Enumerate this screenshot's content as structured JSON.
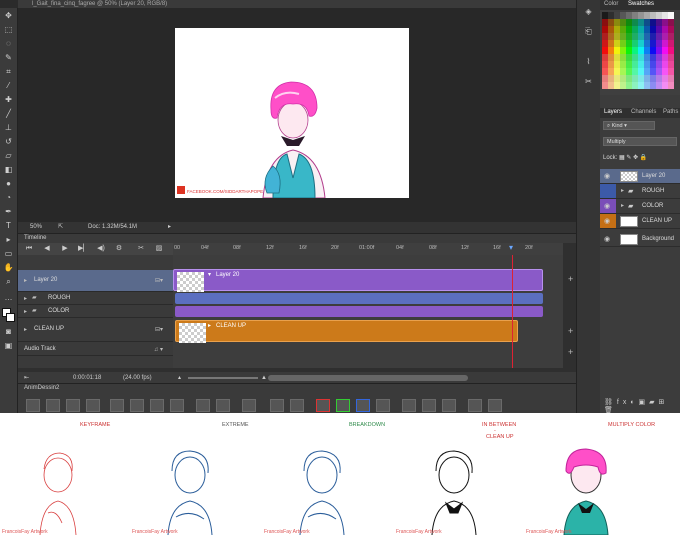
{
  "window": {
    "title": "l_Gait_fina_cinq_fagree @ 50% (Layer 20, RGB/8)"
  },
  "canvas": {
    "zoom": "50%",
    "doc_info": "Doc: 1.32M/54.1M",
    "watermark": "FACEBOOK.COM/SIDDARTHAPOPE"
  },
  "timeline": {
    "title": "Timeline",
    "ruler_marks": [
      "00",
      "04f",
      "08f",
      "12f",
      "16f",
      "20f",
      "01:00f",
      "04f",
      "08f",
      "12f",
      "16f",
      "20f"
    ],
    "rows": [
      {
        "label": "Layer 20"
      },
      {
        "label": "ROUGH"
      },
      {
        "label": "COLOR"
      },
      {
        "label": "CLEAN UP"
      },
      {
        "label": "Audio Track"
      }
    ],
    "clips": {
      "layer20": "Layer 20",
      "cleanup": "CLEAN UP"
    },
    "timecode": "0:00:01:18",
    "fps": "(24.00 fps)"
  },
  "anim_panel": {
    "title": "AnimDessin2"
  },
  "right_panel": {
    "top_tabs": [
      "Color",
      "Swatches"
    ],
    "layer_tabs": [
      "Layers",
      "Channels",
      "Paths"
    ],
    "kind_label": "Kind",
    "blend_mode": "Multiply",
    "lock_label": "Lock:",
    "layers": [
      {
        "name": "Layer 20",
        "type": "layer"
      },
      {
        "name": "ROUGH",
        "type": "group"
      },
      {
        "name": "COLOR",
        "type": "group"
      },
      {
        "name": "CLEAN UP",
        "type": "layer"
      },
      {
        "name": "Background",
        "type": "background"
      }
    ]
  },
  "stages": [
    {
      "label": "KEYFRAME",
      "color": "#d94040"
    },
    {
      "label": "EXTREME",
      "color": "#555555"
    },
    {
      "label": "BREAKDOWN",
      "color": "#2e8a4a"
    },
    {
      "label": "IN BETWEEN",
      "color": "#d94040"
    },
    {
      "label": "CLEAN UP",
      "color": "#d94040"
    },
    {
      "label": "MULTIPLY COLOR",
      "color": "#d94040"
    }
  ],
  "signature": "FrancoisFay Artwork",
  "colors": {
    "purple_clip": "#8a5ac8",
    "blue_clip": "#5b6fc0",
    "orange_clip": "#cc7a1a",
    "hair_pink": "#ff4fc8",
    "suit_teal": "#2bb3a8"
  }
}
